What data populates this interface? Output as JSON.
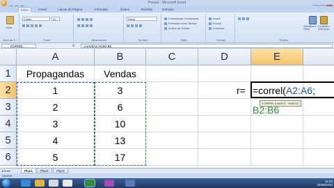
{
  "window": {
    "title": "Pasta1 - Microsoft Excel"
  },
  "ribbon_tabs": [
    "Início",
    "Inserir",
    "Layout da Página",
    "Fórmulas",
    "Dados",
    "Revisão",
    "Exibição"
  ],
  "ribbon": {
    "paste_label": "Colar",
    "clipboard_group": "Área de T...",
    "font_name": "Calibri",
    "font_size": "11",
    "font_group": "Fonte",
    "alignment_group": "Alinhamento",
    "number_format": "Geral",
    "number_group": "Número",
    "cond_format_label": "Formatação Condicional",
    "format_table_label": "Formatar como Tabela",
    "cell_styles_label": "Estilos de Célula",
    "styles_group": "Estilo",
    "insert_label": "Inserir",
    "delete_label": "Excluir",
    "format_label": "Formatar",
    "cells_group": "Células",
    "sort_filter_label": "Classificar e Filtrar",
    "find_select_label": "Localizar e Selecionar",
    "editing_group": "Edição"
  },
  "formula_bar": {
    "name_box": "CORREL",
    "fx": "fx",
    "formula": "=correl(A2:A6;B2:B6"
  },
  "columns": [
    "A",
    "B",
    "C",
    "D",
    "E"
  ],
  "rows": [
    "1",
    "2",
    "3",
    "4",
    "5",
    "6"
  ],
  "cells": {
    "A1": "Propagandas",
    "B1": "Vendas",
    "A2": "1",
    "B2": "3",
    "A3": "2",
    "B3": "6",
    "A4": "3",
    "B4": "10",
    "A5": "4",
    "B5": "13",
    "A6": "5",
    "B6": "17"
  },
  "editing": {
    "label": "r=",
    "formula_part1": "=correl(",
    "ref1": "A2:A6",
    "sep": ";",
    "ref2": "B2:B6",
    "tooltip": "CORREL(matriz1; matriz2)"
  },
  "sheet_tabs": [
    "Plan1",
    "Plan2",
    "Plan3"
  ],
  "status": "Aponte",
  "taskbar": {
    "time": "11:23",
    "date": "23/08/2012"
  },
  "colors": {
    "ref1_color": "#1f4fbf",
    "ref2_color": "#2e8b2e",
    "selection_header": "#f3c36a"
  }
}
